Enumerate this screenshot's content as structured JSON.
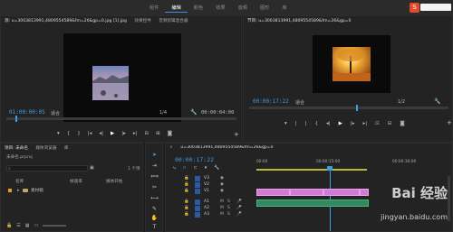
{
  "topbar": {
    "tabs": [
      {
        "label": "组件",
        "active": false
      },
      {
        "label": "编辑",
        "active": true
      },
      {
        "label": "颜色",
        "active": false
      },
      {
        "label": "效果",
        "active": false
      },
      {
        "label": "音频",
        "active": false
      },
      {
        "label": "图形",
        "active": false
      },
      {
        "label": "库",
        "active": false
      }
    ]
  },
  "source_monitor": {
    "tab_label": "源: u=3003813991,4809554589&fm=26&gp=0.jpg [1].jpg",
    "extra_tabs": [
      "效果控件",
      "音频剪辑混合器"
    ],
    "timecode": "01:00:00:05",
    "fit_label": "适合",
    "zoom_label": "1/4",
    "duration": "00:00:04:00"
  },
  "program_monitor": {
    "tab_label": "节目: u=3003813991,4809554589&fm=26&gp=0",
    "timecode": "00:00:17:22",
    "fit_label": "适合",
    "zoom_label": "1/2"
  },
  "project_panel": {
    "tab_label": "项目: 未命名",
    "extra_tabs": [
      "媒体浏览器",
      "库"
    ],
    "project_name": "未命名.prproj",
    "item_count": "1 个项",
    "columns": {
      "name": "名称",
      "framerate": "帧速率",
      "media_start": "媒体开始"
    },
    "items": [
      {
        "name": "素材箱"
      }
    ]
  },
  "timeline": {
    "tab_label": "u=3003813991,4809554589&fm=26&gp=0",
    "timecode": "00:00:17:22",
    "ruler_labels": [
      "00:00",
      "00:00:15:00",
      "00:00:30:00"
    ],
    "tracks": [
      {
        "name": "V3",
        "kind": "video"
      },
      {
        "name": "V2",
        "kind": "video"
      },
      {
        "name": "V1",
        "kind": "video"
      },
      {
        "name": "A1",
        "kind": "audio"
      },
      {
        "name": "A2",
        "kind": "audio"
      },
      {
        "name": "A3",
        "kind": "audio"
      }
    ],
    "clip_color_video": "#d27ad6",
    "clip_color_audio": "#2f8a5f",
    "playhead_color": "#3b9de6"
  },
  "watermark": {
    "brand": "Bai 经验",
    "url": "jingyan.baidu.com"
  },
  "accent_color": "#3b9de6"
}
